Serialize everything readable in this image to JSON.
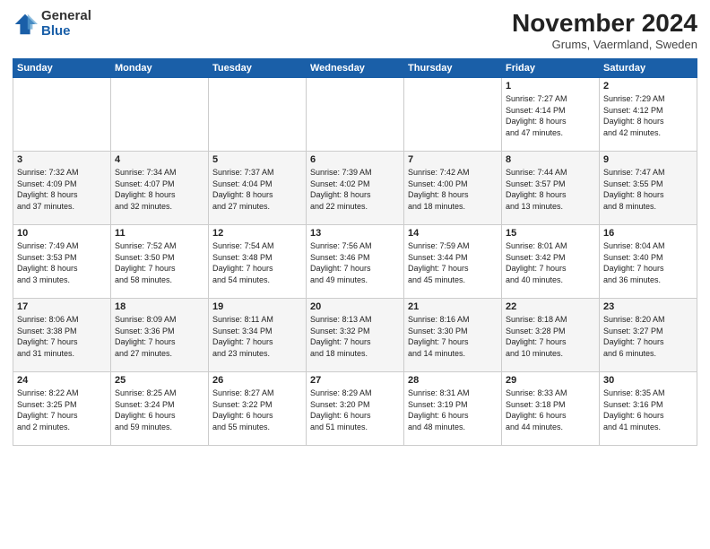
{
  "logo": {
    "general": "General",
    "blue": "Blue"
  },
  "title": "November 2024",
  "subtitle": "Grums, Vaermland, Sweden",
  "days_of_week": [
    "Sunday",
    "Monday",
    "Tuesday",
    "Wednesday",
    "Thursday",
    "Friday",
    "Saturday"
  ],
  "weeks": [
    [
      {
        "day": "",
        "info": ""
      },
      {
        "day": "",
        "info": ""
      },
      {
        "day": "",
        "info": ""
      },
      {
        "day": "",
        "info": ""
      },
      {
        "day": "",
        "info": ""
      },
      {
        "day": "1",
        "info": "Sunrise: 7:27 AM\nSunset: 4:14 PM\nDaylight: 8 hours\nand 47 minutes."
      },
      {
        "day": "2",
        "info": "Sunrise: 7:29 AM\nSunset: 4:12 PM\nDaylight: 8 hours\nand 42 minutes."
      }
    ],
    [
      {
        "day": "3",
        "info": "Sunrise: 7:32 AM\nSunset: 4:09 PM\nDaylight: 8 hours\nand 37 minutes."
      },
      {
        "day": "4",
        "info": "Sunrise: 7:34 AM\nSunset: 4:07 PM\nDaylight: 8 hours\nand 32 minutes."
      },
      {
        "day": "5",
        "info": "Sunrise: 7:37 AM\nSunset: 4:04 PM\nDaylight: 8 hours\nand 27 minutes."
      },
      {
        "day": "6",
        "info": "Sunrise: 7:39 AM\nSunset: 4:02 PM\nDaylight: 8 hours\nand 22 minutes."
      },
      {
        "day": "7",
        "info": "Sunrise: 7:42 AM\nSunset: 4:00 PM\nDaylight: 8 hours\nand 18 minutes."
      },
      {
        "day": "8",
        "info": "Sunrise: 7:44 AM\nSunset: 3:57 PM\nDaylight: 8 hours\nand 13 minutes."
      },
      {
        "day": "9",
        "info": "Sunrise: 7:47 AM\nSunset: 3:55 PM\nDaylight: 8 hours\nand 8 minutes."
      }
    ],
    [
      {
        "day": "10",
        "info": "Sunrise: 7:49 AM\nSunset: 3:53 PM\nDaylight: 8 hours\nand 3 minutes."
      },
      {
        "day": "11",
        "info": "Sunrise: 7:52 AM\nSunset: 3:50 PM\nDaylight: 7 hours\nand 58 minutes."
      },
      {
        "day": "12",
        "info": "Sunrise: 7:54 AM\nSunset: 3:48 PM\nDaylight: 7 hours\nand 54 minutes."
      },
      {
        "day": "13",
        "info": "Sunrise: 7:56 AM\nSunset: 3:46 PM\nDaylight: 7 hours\nand 49 minutes."
      },
      {
        "day": "14",
        "info": "Sunrise: 7:59 AM\nSunset: 3:44 PM\nDaylight: 7 hours\nand 45 minutes."
      },
      {
        "day": "15",
        "info": "Sunrise: 8:01 AM\nSunset: 3:42 PM\nDaylight: 7 hours\nand 40 minutes."
      },
      {
        "day": "16",
        "info": "Sunrise: 8:04 AM\nSunset: 3:40 PM\nDaylight: 7 hours\nand 36 minutes."
      }
    ],
    [
      {
        "day": "17",
        "info": "Sunrise: 8:06 AM\nSunset: 3:38 PM\nDaylight: 7 hours\nand 31 minutes."
      },
      {
        "day": "18",
        "info": "Sunrise: 8:09 AM\nSunset: 3:36 PM\nDaylight: 7 hours\nand 27 minutes."
      },
      {
        "day": "19",
        "info": "Sunrise: 8:11 AM\nSunset: 3:34 PM\nDaylight: 7 hours\nand 23 minutes."
      },
      {
        "day": "20",
        "info": "Sunrise: 8:13 AM\nSunset: 3:32 PM\nDaylight: 7 hours\nand 18 minutes."
      },
      {
        "day": "21",
        "info": "Sunrise: 8:16 AM\nSunset: 3:30 PM\nDaylight: 7 hours\nand 14 minutes."
      },
      {
        "day": "22",
        "info": "Sunrise: 8:18 AM\nSunset: 3:28 PM\nDaylight: 7 hours\nand 10 minutes."
      },
      {
        "day": "23",
        "info": "Sunrise: 8:20 AM\nSunset: 3:27 PM\nDaylight: 7 hours\nand 6 minutes."
      }
    ],
    [
      {
        "day": "24",
        "info": "Sunrise: 8:22 AM\nSunset: 3:25 PM\nDaylight: 7 hours\nand 2 minutes."
      },
      {
        "day": "25",
        "info": "Sunrise: 8:25 AM\nSunset: 3:24 PM\nDaylight: 6 hours\nand 59 minutes."
      },
      {
        "day": "26",
        "info": "Sunrise: 8:27 AM\nSunset: 3:22 PM\nDaylight: 6 hours\nand 55 minutes."
      },
      {
        "day": "27",
        "info": "Sunrise: 8:29 AM\nSunset: 3:20 PM\nDaylight: 6 hours\nand 51 minutes."
      },
      {
        "day": "28",
        "info": "Sunrise: 8:31 AM\nSunset: 3:19 PM\nDaylight: 6 hours\nand 48 minutes."
      },
      {
        "day": "29",
        "info": "Sunrise: 8:33 AM\nSunset: 3:18 PM\nDaylight: 6 hours\nand 44 minutes."
      },
      {
        "day": "30",
        "info": "Sunrise: 8:35 AM\nSunset: 3:16 PM\nDaylight: 6 hours\nand 41 minutes."
      }
    ]
  ]
}
